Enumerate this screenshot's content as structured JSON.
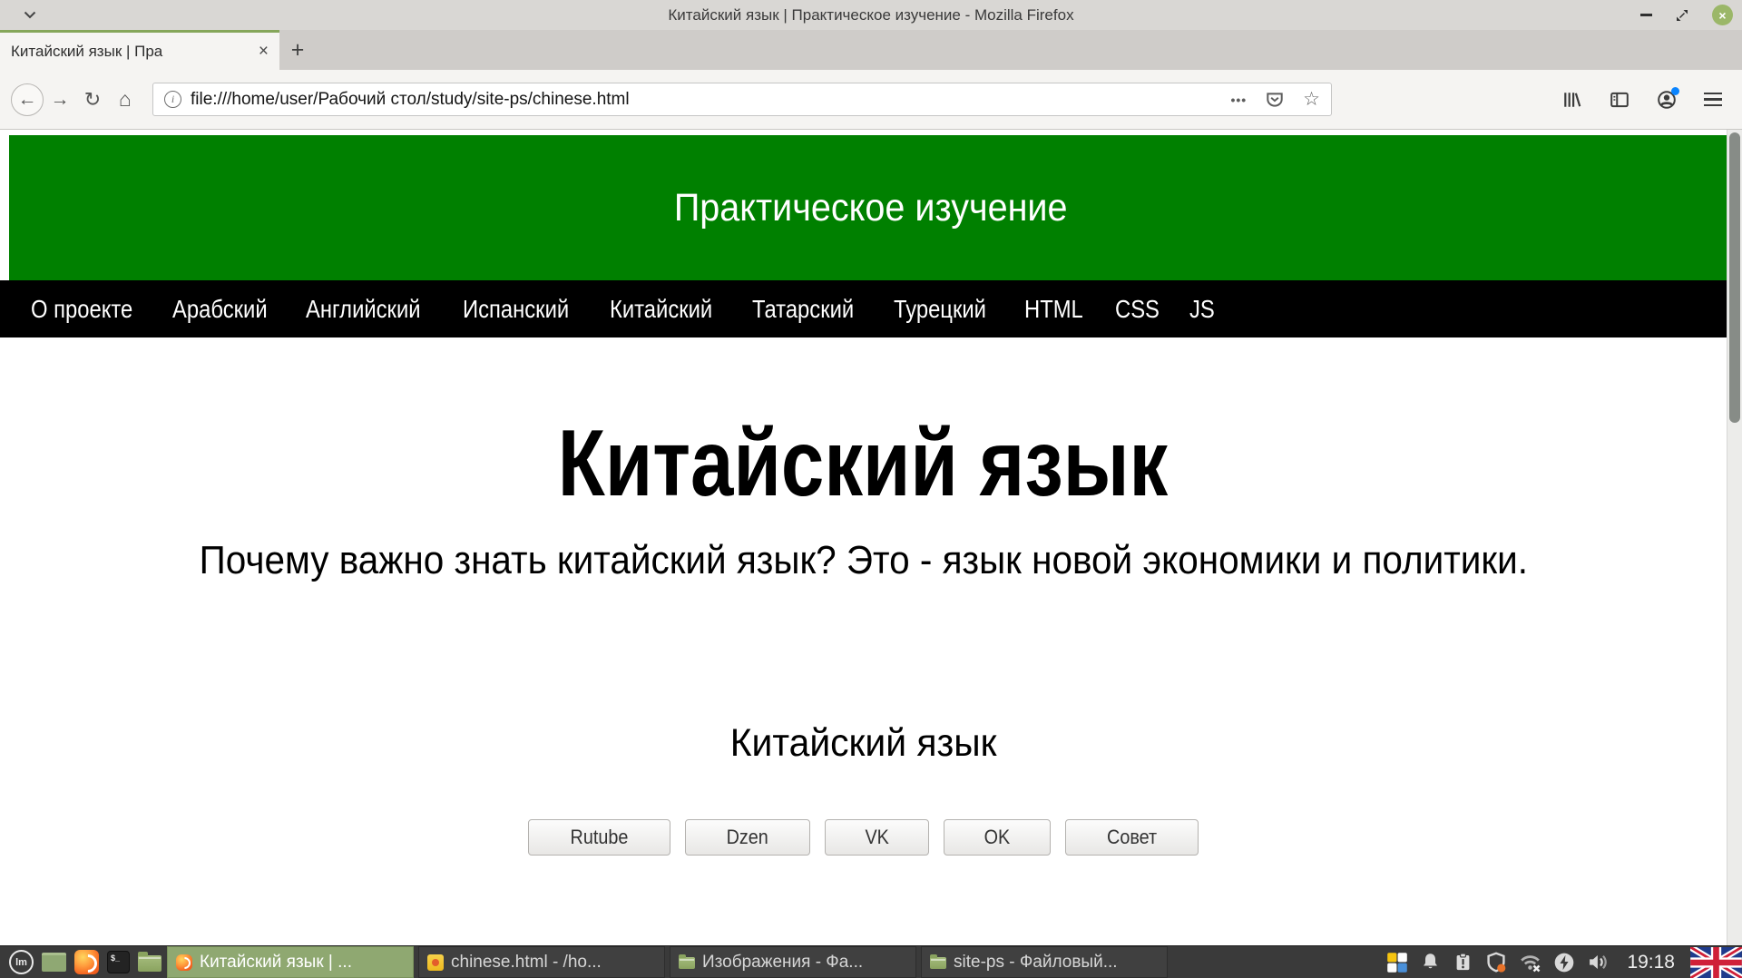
{
  "window": {
    "title": "Китайский язык | Практическое изучение - Mozilla Firefox",
    "close_glyph": "×"
  },
  "tabbar": {
    "active_tab": {
      "title": "Китайский язык | Пра",
      "close_glyph": "×"
    },
    "new_tab_glyph": "+"
  },
  "toolbar": {
    "url": "file:///home/user/Рабочий стол/study/site-ps/chinese.html",
    "icons": {
      "back": "←",
      "forward": "→",
      "reload": "↻",
      "home": "⌂",
      "info": "i",
      "page_actions": "•••",
      "bookmark_star": "☆"
    }
  },
  "page": {
    "banner": {
      "title": "Практическое изучение",
      "bg": "#008000"
    },
    "nav": {
      "bg": "#000000",
      "items": [
        "О проекте",
        "Арабский",
        "Английский",
        "Испанский",
        "Китайский",
        "Татарский",
        "Турецкий",
        "HTML",
        "CSS",
        "JS"
      ]
    },
    "heading": "Китайский язык",
    "paragraph": "Почему важно знать китайский язык? Это - язык новой экономики и политики.",
    "subheading": "Китайский язык",
    "buttons": [
      "Rutube",
      "Dzen",
      "VK",
      "OK",
      "Совет"
    ]
  },
  "taskbar": {
    "launcher_glyphs": {
      "mint": "lm",
      "terminal": "$_"
    },
    "windows": [
      {
        "title": "Китайский язык | ...",
        "active": true
      },
      {
        "title": "chinese.html - /ho...",
        "active": false
      },
      {
        "title": "Изображения - Фа...",
        "active": false
      },
      {
        "title": "site-ps - Файловый...",
        "active": false
      }
    ],
    "clock": "19:18"
  },
  "colors": {
    "accent_tab_green": "#85a65a",
    "taskbar_active_green": "#8fa871",
    "page_header_green": "#008000",
    "nav_black": "#000000",
    "close_button_green": "#9bb768"
  }
}
